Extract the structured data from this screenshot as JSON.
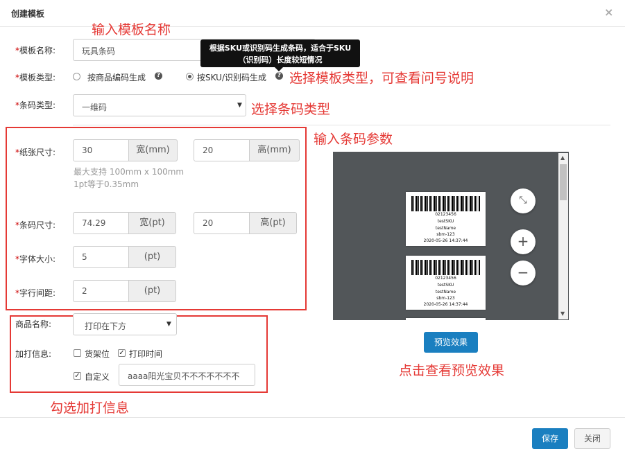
{
  "dialog": {
    "title": "创建模板",
    "close": "×"
  },
  "form": {
    "name_label": "模板名称:",
    "name_value": "玩具条码",
    "type_label": "模板类型:",
    "type_option1": "按商品编码生成",
    "type_option2": "按SKU/识别码生成",
    "tooltip_line1": "根据SKU或识别码生成条码，适合于SKU",
    "tooltip_line2": "（识别码）长度较短情况",
    "barcode_type_label": "条码类型:",
    "barcode_type_value": "一维码",
    "paper_label": "纸张尺寸:",
    "paper_width": "30",
    "paper_width_unit": "宽(mm)",
    "paper_height": "20",
    "paper_height_unit": "高(mm)",
    "paper_hint1": "最大支持 100mm x 100mm",
    "paper_hint2": "1pt等于0.35mm",
    "barcode_size_label": "条码尺寸:",
    "barcode_width": "74.29",
    "barcode_width_unit": "宽(pt)",
    "barcode_height": "20",
    "barcode_height_unit": "高(pt)",
    "font_label": "字体大小:",
    "font_value": "5",
    "font_unit": "(pt)",
    "spacing_label": "字行间距:",
    "spacing_value": "2",
    "spacing_unit": "(pt)",
    "product_name_label": "商品名称:",
    "product_name_value": "打印在下方",
    "extra_label": "加打信息:",
    "extra_shelf": "货架位",
    "extra_time": "打印时间",
    "extra_custom": "自定义",
    "extra_custom_value": "aaaa阳光宝贝不不不不不不不",
    "extra_shelf_checked": false,
    "extra_time_checked": true,
    "extra_custom_checked": true
  },
  "annotations": {
    "name": "输入模板名称",
    "type": "选择模板类型，可查看问号说明",
    "barcode_type": "选择条码类型",
    "params": "输入条码参数",
    "extra": "勾选加打信息",
    "preview": "点击查看预览效果"
  },
  "preview": {
    "code": "02123456",
    "sku": "testSKU",
    "name": "testName",
    "shelf": "sbm-123",
    "time": "2020-05-26 14:37:44",
    "button": "预览效果",
    "zoom_fit_icon": "compress-icon",
    "zoom_in_icon": "plus-icon",
    "zoom_out_icon": "minus-icon"
  },
  "footer": {
    "save": "保存",
    "close": "关闭"
  },
  "colors": {
    "accent": "#1a7fc0",
    "annotation": "#e53935",
    "preview_bg": "#525659"
  }
}
